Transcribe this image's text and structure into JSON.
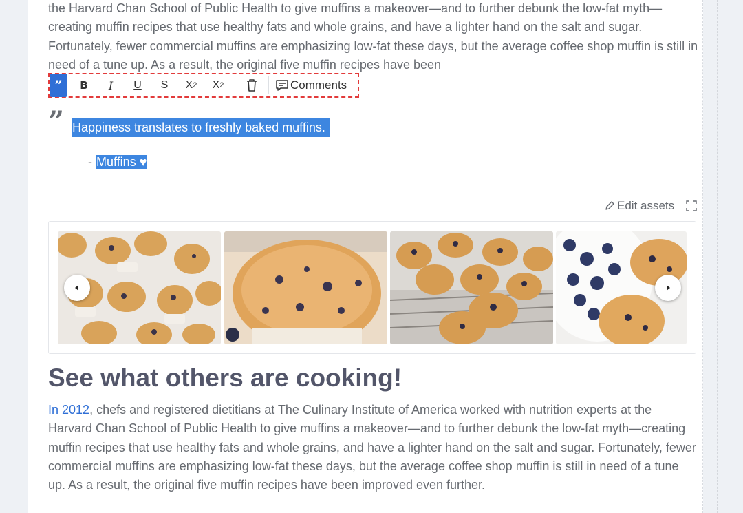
{
  "top_paragraph": "the Harvard Chan School of Public Health to give muffins a makeover—and to further debunk the low-fat myth—creating muffin recipes that use healthy fats and whole grains, and have a lighter hand on the salt and sugar. Fortunately, fewer commercial muffins are emphasizing low-fat these days, but the average coffee shop muffin is still in need of a tune up. As a result, the original five muffin recipes have been",
  "toolbar": {
    "blockquote_label": "”",
    "bold_label": "B",
    "italic_label": "I",
    "underline_label": "U",
    "strike_label": "S",
    "subscript_label": "X",
    "subscript_sub": "2",
    "superscript_label": "X",
    "superscript_sup": "2",
    "comments_label": "Comments"
  },
  "quote": {
    "mark": "”",
    "text": "Happiness translates to freshly baked muffins.",
    "cite_prefix": "- ",
    "cite": "Muffins ♥"
  },
  "assets": {
    "edit_label": "Edit assets"
  },
  "gallery": {
    "slides": [
      "muffins-on-table",
      "blueberry-muffin-closeup",
      "muffins-on-rack",
      "blueberry-bowl-muffins"
    ]
  },
  "section": {
    "heading": "See what others are cooking!",
    "link_text": "In 2012",
    "paragraph_rest": ", chefs and registered dietitians at The Culinary Institute of America worked with nutrition experts at the Harvard Chan School of Public Health to give muffins a makeover—and to further debunk the low-fat myth—creating muffin recipes that use healthy fats and whole grains, and have a lighter hand on the salt and sugar. Fortunately, fewer commercial muffins are emphasizing low-fat these days, but the average coffee shop muffin is still in need of a tune up. As a result, the original five muffin recipes have been improved even further."
  },
  "colors": {
    "accent": "#2f6fd6",
    "selection": "#3d86e0",
    "toolbar_border": "#e23b3b",
    "body_text": "#666a70",
    "heading": "#53566a"
  }
}
